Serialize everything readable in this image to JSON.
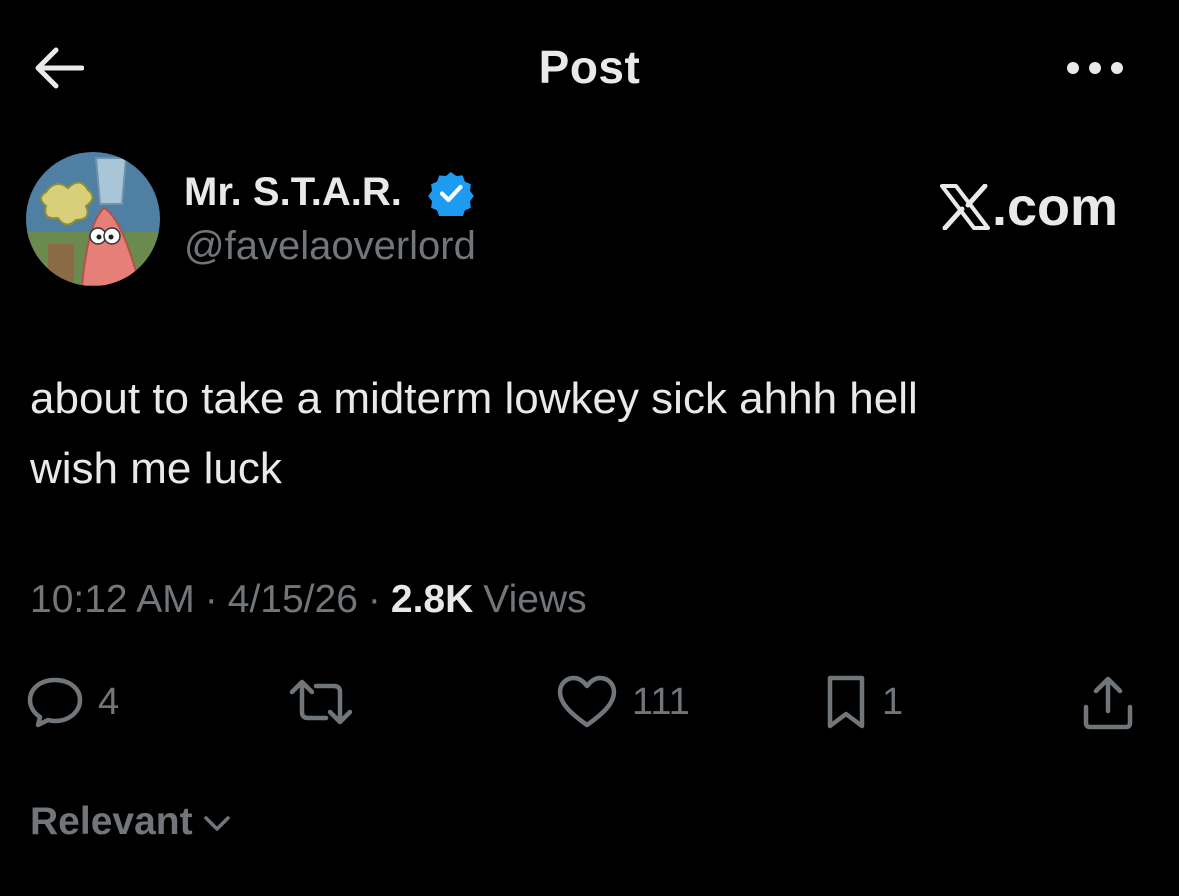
{
  "header": {
    "title": "Post",
    "back_icon": "arrow-left-icon",
    "more_icon": "more-horizontal-icon"
  },
  "author": {
    "display_name": "Mr. S.T.A.R.",
    "handle": "@favelaoverlord",
    "verified_icon": "verified-badge-icon",
    "verified_color": "#1d9bf0"
  },
  "watermark": {
    "text": ".com",
    "logo_icon": "x-logo-icon"
  },
  "post": {
    "lines": [
      "about to take a midterm lowkey sick ahhh hell",
      "wish me luck"
    ]
  },
  "meta": {
    "time": "10:12 AM",
    "separator": "·",
    "date": "4/15/26",
    "views_count": "2.8K",
    "views_label": "Views"
  },
  "actions": {
    "reply_count": "4",
    "repost_count": "",
    "like_count": "111",
    "bookmark_count": "1"
  },
  "replies_sort": {
    "label": "Relevant"
  },
  "colors": {
    "background": "#000000",
    "primary_text": "#e7e9ea",
    "secondary_text": "#71767b",
    "accent": "#1d9bf0"
  }
}
